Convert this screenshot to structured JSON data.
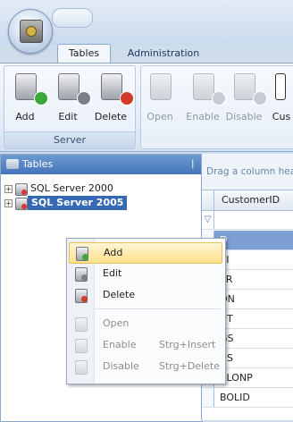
{
  "ribbon": {
    "tabs": [
      {
        "label": "Tables"
      },
      {
        "label": "Administration"
      }
    ],
    "server_group": {
      "label": "Server",
      "buttons": [
        {
          "label": "Add",
          "icon": "add-server-icon"
        },
        {
          "label": "Edit",
          "icon": "edit-server-icon"
        },
        {
          "label": "Delete",
          "icon": "delete-server-icon"
        }
      ]
    },
    "actions_group": {
      "buttons": [
        {
          "label": "Open",
          "icon": "open-table-icon"
        },
        {
          "label": "Enable",
          "icon": "enable-table-icon"
        },
        {
          "label": "Disable",
          "icon": "disable-table-icon"
        },
        {
          "label": "Cus",
          "icon": "customize-icon"
        }
      ]
    }
  },
  "tables_pane": {
    "title": "Tables",
    "pin_glyph": "❘",
    "tree": [
      {
        "label": "SQL Server 2000",
        "expander": "+",
        "selected": false
      },
      {
        "label": "SQL Server 2005",
        "expander": "+",
        "selected": true
      }
    ]
  },
  "grid": {
    "drag_hint": "Drag a column head",
    "column_header": "CustomerID",
    "filter_glyph": "▽",
    "rows": [
      "D",
      "KI",
      "TR",
      "ON",
      "UT",
      "GS",
      "US",
      "BLONP",
      "BOLID"
    ]
  },
  "context_menu": {
    "items": [
      {
        "label": "Add",
        "shortcut": "",
        "enabled": true,
        "highlighted": true,
        "icon": "add-icon"
      },
      {
        "label": "Edit",
        "shortcut": "",
        "enabled": true,
        "highlighted": false,
        "icon": "edit-icon"
      },
      {
        "label": "Delete",
        "shortcut": "",
        "enabled": true,
        "highlighted": false,
        "icon": "delete-icon"
      },
      {
        "label": "Open",
        "shortcut": "",
        "enabled": false,
        "highlighted": false,
        "icon": "open-icon"
      },
      {
        "label": "Enable",
        "shortcut": "Strg+Insert",
        "enabled": false,
        "highlighted": false,
        "icon": "enable-icon"
      },
      {
        "label": "Disable",
        "shortcut": "Strg+Delete",
        "enabled": false,
        "highlighted": false,
        "icon": "disable-icon"
      }
    ]
  },
  "colors": {
    "pane_header": "#4475b9",
    "tree_selection": "#3569b3",
    "menu_highlight": "#ffe08a",
    "grid_selection": "#7d9fd3"
  }
}
